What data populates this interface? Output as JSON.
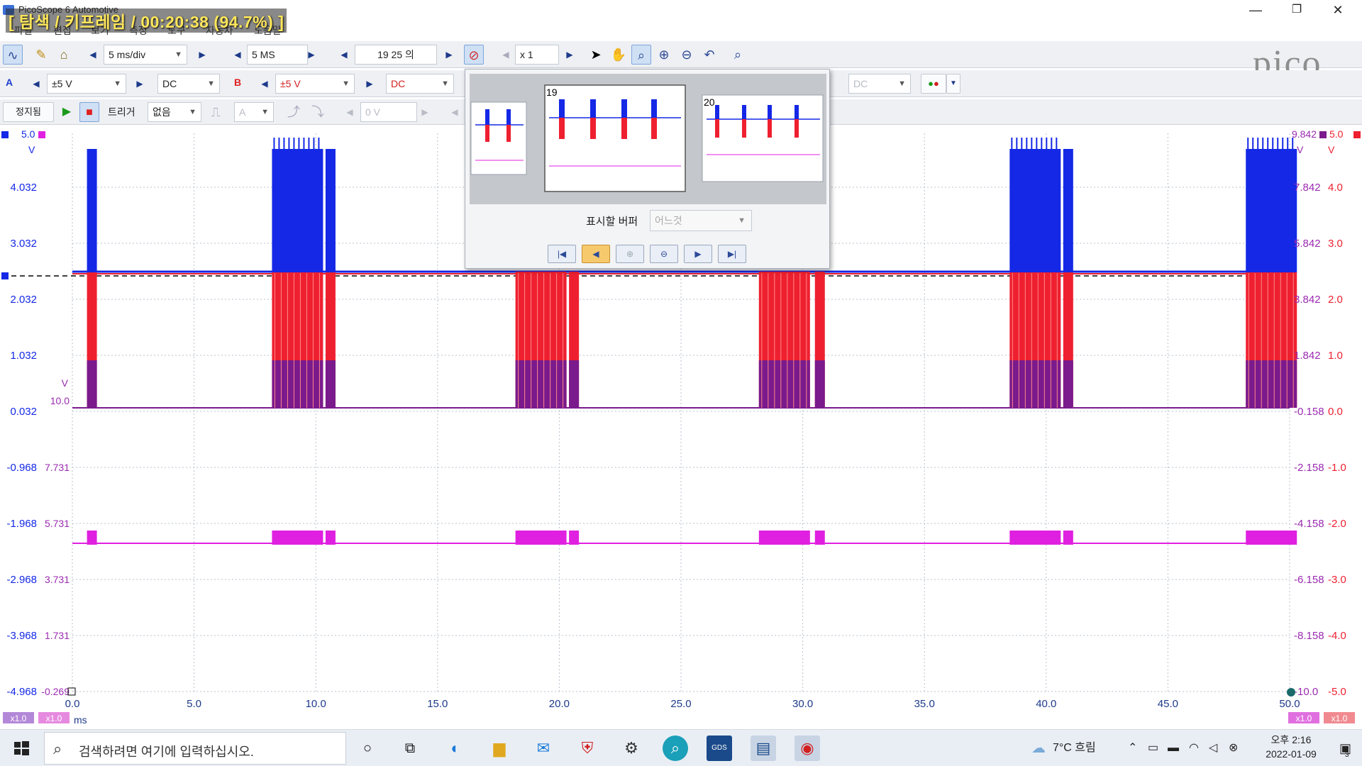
{
  "window": {
    "app_title": "PicoScope 6 Automotive",
    "overlay_title": "[ 탐색 / 키프레임 / 00:20:38 (94.7%) ]",
    "controls": {
      "minimize": "—",
      "restore": "❐",
      "close": "✕"
    }
  },
  "menu": {
    "items": [
      "파일",
      "편집",
      "보기",
      "측정",
      "도구",
      "자동차",
      "도움말"
    ]
  },
  "toolbar1": {
    "timebase": "5 ms/div",
    "samples": "5 MS",
    "buffer_position": "19 25 의",
    "zoom": "x 1"
  },
  "toolbar2": {
    "channel_a": {
      "label": "A",
      "range": "±5 V",
      "coupling": "DC",
      "color": "#1f3fd0"
    },
    "channel_b": {
      "label": "B",
      "range": "±5 V",
      "coupling": "DC",
      "color": "#e02020"
    },
    "channel_dim_coupling": "DC"
  },
  "toolbar3": {
    "run_state": "정지됨",
    "trigger_label": "트리거",
    "trigger_mode": "없음",
    "trigger_source": "A",
    "trigger_level": "0 V"
  },
  "popup": {
    "thumb_numbers": [
      "19",
      "20"
    ],
    "buffer_label": "표시할 버퍼",
    "buffer_select": "어느것"
  },
  "scope": {
    "left_axis_top_label": "5.0",
    "left_axis_unit": "V",
    "left_axis_ticks": [
      "4.032",
      "3.032",
      "2.032",
      "1.032",
      "0.032",
      "-0.968",
      "-1.968",
      "-2.968",
      "-3.968",
      "-4.968"
    ],
    "left_axis2_unit": "V",
    "left_axis2_ticks": [
      "10.0",
      "7.731",
      "5.731",
      "3.731",
      "1.731",
      "-0.269"
    ],
    "right_axis1_top": "9.842",
    "right_axis1_unit": "V",
    "right_axis1_ticks": [
      "7.842",
      "5.842",
      "3.842",
      "1.842",
      "-0.158",
      "-2.158",
      "-4.158",
      "-6.158",
      "-8.158",
      "-10.0"
    ],
    "right_axis2_top": "5.0",
    "right_axis2_unit": "V",
    "right_axis2_ticks": [
      "4.0",
      "3.0",
      "2.0",
      "1.0",
      "0.0",
      "-1.0",
      "-2.0",
      "-3.0",
      "-4.0",
      "-5.0"
    ],
    "x_ticks": [
      "0.0",
      "5.0",
      "10.0",
      "15.0",
      "20.0",
      "25.0",
      "30.0",
      "35.0",
      "40.0",
      "45.0",
      "50.0"
    ],
    "x_unit": "ms",
    "scale_badges": [
      "x1.0",
      "x1.0",
      "x1.0",
      "x1.0"
    ],
    "colors": {
      "channel_a": "#1428e6",
      "channel_b": "#ee2030",
      "math_purple": "#7a1a8c",
      "channel_c": "#e020e0"
    }
  },
  "chart_data": {
    "type": "line",
    "xlabel": "ms",
    "xlim": [
      0,
      50
    ],
    "series": [
      {
        "name": "A",
        "baseline_v": 2.2,
        "burst_times_ms": [
          0.6,
          8.2,
          10.4,
          38.5,
          40.7,
          48.2
        ]
      },
      {
        "name": "B",
        "baseline_v": 2.2,
        "burst_times_ms": [
          0.6,
          8.2,
          10.4,
          18.2,
          20.4,
          28.2,
          30.5,
          38.5,
          40.7,
          48.2
        ]
      }
    ]
  },
  "taskbar": {
    "search_placeholder": "검색하려면 여기에 입력하십시오.",
    "weather": "7°C 흐림",
    "time": "오후 2:16",
    "date": "2022-01-09",
    "notification_count": "3"
  }
}
